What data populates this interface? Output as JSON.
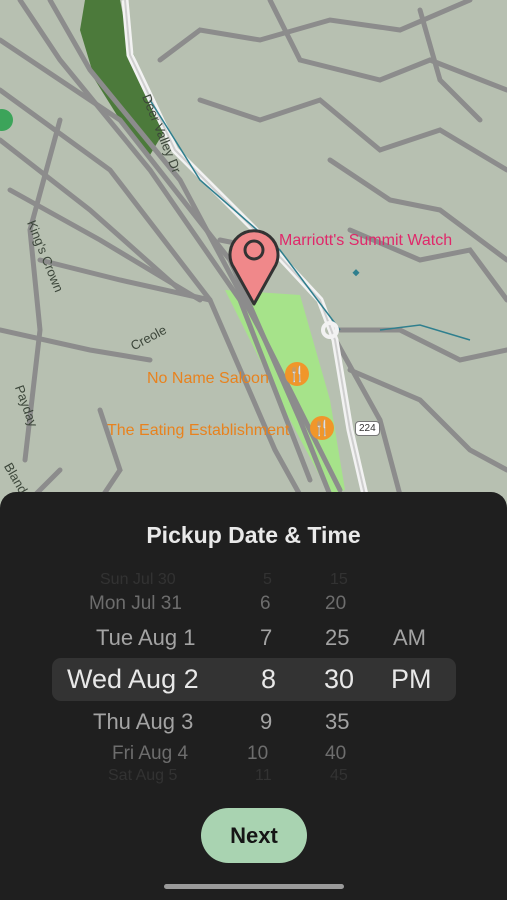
{
  "map": {
    "streets": [
      "Deer Valley Dr",
      "King's Crown",
      "Creole",
      "Payday",
      "Bland"
    ],
    "places": [
      {
        "name": "Marriott's Summit Watch",
        "color": "#e0286a"
      },
      {
        "name": "No Name Saloon",
        "color": "#e8821e",
        "icon": "fork-knife-icon"
      },
      {
        "name": "The Eating Establishment",
        "color": "#e8821e",
        "icon": "fork-knife-icon"
      }
    ],
    "highway_badge": "224",
    "pin_color": "#f0888a"
  },
  "sheet": {
    "title": "Pickup Date & Time",
    "next_label": "Next",
    "accent": "#a9d3b1"
  },
  "picker": {
    "dates": [
      "Sun Jul 30",
      "Mon Jul 31",
      "Tue Aug 1",
      "Wed Aug 2",
      "Thu Aug 3",
      "Fri Aug 4",
      "Sat Aug 5"
    ],
    "hours": [
      "5",
      "6",
      "7",
      "8",
      "9",
      "10",
      "11"
    ],
    "minutes": [
      "15",
      "20",
      "25",
      "30",
      "35",
      "40",
      "45"
    ],
    "periods": [
      "AM",
      "PM"
    ],
    "selected": {
      "date": "Wed Aug 2",
      "hour": "8",
      "minute": "30",
      "period": "PM"
    }
  }
}
